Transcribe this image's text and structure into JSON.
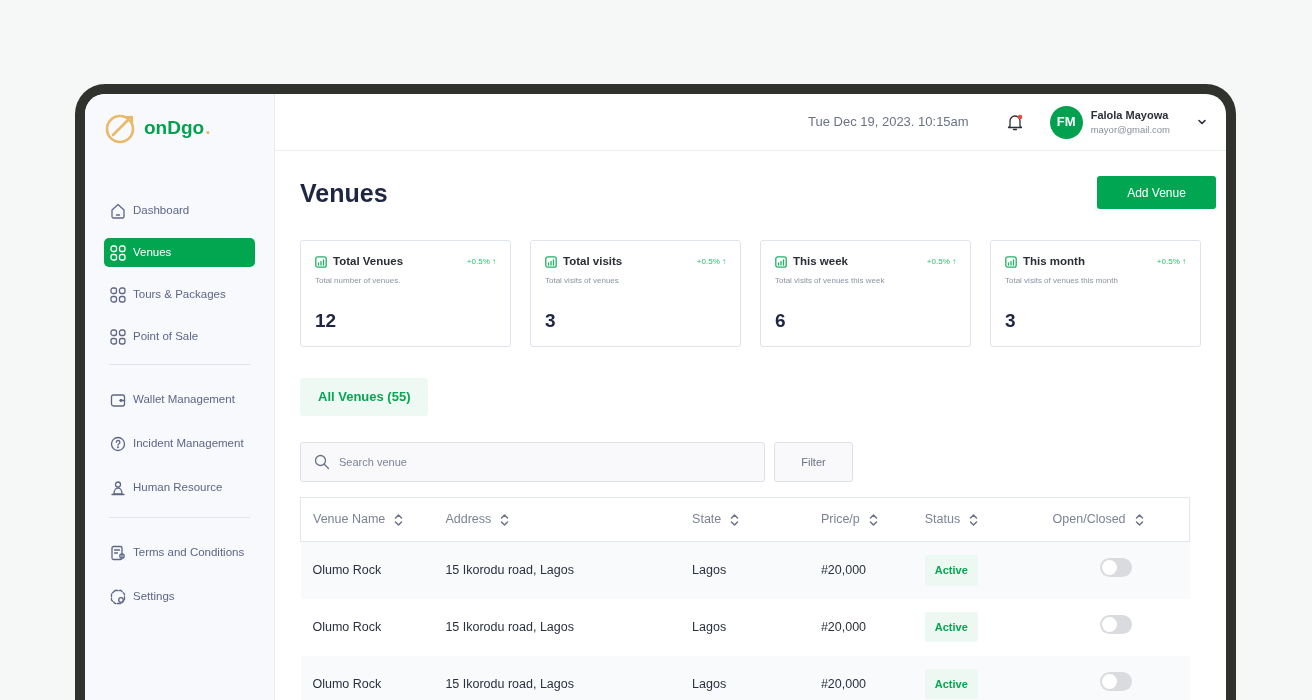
{
  "logo": {
    "name": "onDgo",
    "dot": "."
  },
  "sidebar": {
    "groups": [
      [
        {
          "label": "Dashboard",
          "selected": false
        },
        {
          "label": "Venues",
          "selected": true
        },
        {
          "label": "Tours & Packages",
          "selected": false
        },
        {
          "label": "Point of Sale",
          "selected": false
        }
      ],
      [
        {
          "label": "Wallet Management",
          "selected": false
        },
        {
          "label": "Incident Management",
          "selected": false
        },
        {
          "label": "Human Resource",
          "selected": false
        }
      ],
      [
        {
          "label": "Terms and Conditions",
          "selected": false
        },
        {
          "label": "Settings",
          "selected": false
        }
      ]
    ]
  },
  "header": {
    "datetime": "Tue Dec 19, 2023. 10:15am",
    "notification_unread": true,
    "user": {
      "initials": "FM",
      "name": "Falola Mayowa",
      "email": "mayor@gmail.com"
    }
  },
  "page": {
    "title": "Venues",
    "add_button": "Add Venue"
  },
  "stats": [
    {
      "title": "Total Venues",
      "change": "+0.5% ↑",
      "note": "Total number of venues.",
      "value": "12"
    },
    {
      "title": "Total visits",
      "change": "+0.5% ↑",
      "note": "Total visits of venues",
      "value": "3"
    },
    {
      "title": "This week",
      "change": "+0.5% ↑",
      "note": "Total visits of venues this week",
      "value": "6"
    },
    {
      "title": "This month",
      "change": "+0.5% ↑",
      "note": "Total visits of venues this month",
      "value": "3"
    }
  ],
  "tabs": [
    {
      "label": "All Venues (55)",
      "selected": true
    }
  ],
  "search": {
    "placeholder": "Search venue"
  },
  "filter_button": "Filter",
  "table": {
    "columns": [
      "Venue Name",
      "Address",
      "State",
      "Price/p",
      "Status",
      "Open/Closed"
    ],
    "rows": [
      {
        "name": "Olumo Rock",
        "address": "15 Ikorodu road, Lagos",
        "state": "Lagos",
        "price": "#20,000",
        "status": "Active",
        "open": false
      },
      {
        "name": "Olumo Rock",
        "address": "15 Ikorodu road, Lagos",
        "state": "Lagos",
        "price": "#20,000",
        "status": "Active",
        "open": false
      },
      {
        "name": "Olumo Rock",
        "address": "15 Ikorodu road, Lagos",
        "state": "Lagos",
        "price": "#20,000",
        "status": "Active",
        "open": false
      }
    ]
  }
}
